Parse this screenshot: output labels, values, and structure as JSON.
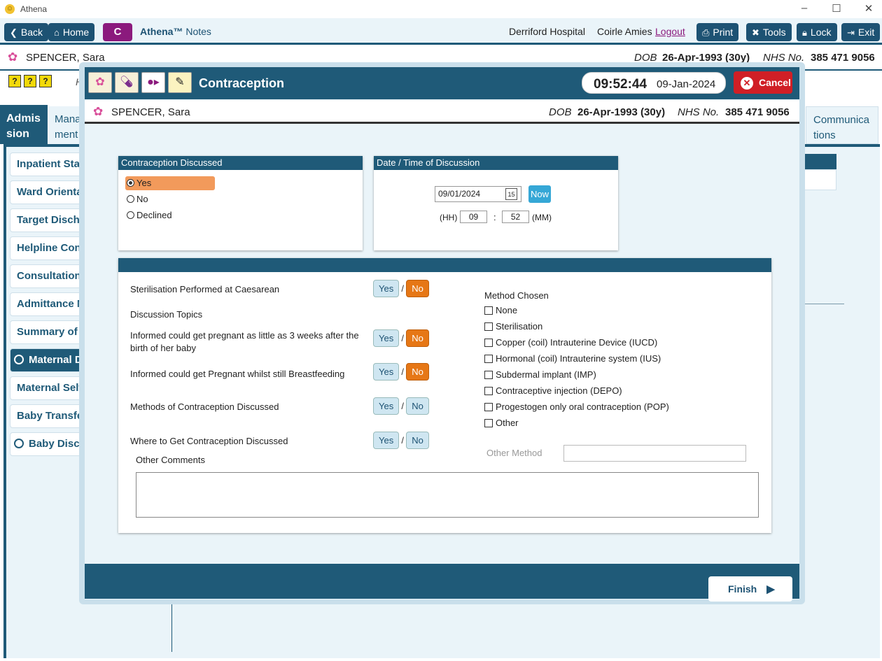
{
  "window": {
    "title": "Athena"
  },
  "topbar": {
    "back": "Back",
    "home": "Home",
    "c": "C",
    "brand_a": "Athena™",
    "brand_b": "Notes",
    "hospital": "Derriford Hospital",
    "user": "Coirle Amies",
    "logout": "Logout",
    "print": "Print",
    "tools": "Tools",
    "lock": "Lock",
    "exit": "Exit"
  },
  "patient": {
    "name": "SPENCER, Sara",
    "dob_label": "DOB",
    "dob": "26-Apr-1993 (30y)",
    "nhs_label": "NHS No.",
    "nhs": "385 471 9056"
  },
  "background": {
    "h_label": "H",
    "tabs": [
      "Admis sion",
      "Mana ment",
      "Communica tions"
    ],
    "items": [
      "Inpatient Stay",
      "Ward Orientat",
      "Target Dischar",
      "Helpline Cont",
      "Consultation I",
      "Admittance N",
      "Summary of P",
      "Maternal Di",
      "Maternal Self",
      "Baby Transfer",
      "Baby Discha"
    ]
  },
  "modal": {
    "title": "Contraception",
    "time": "09:52:44",
    "date": "09-Jan-2024",
    "cancel": "Cancel",
    "discussed": {
      "header": "Contraception Discussed",
      "options": [
        "Yes",
        "No",
        "Declined"
      ],
      "selected": "Yes"
    },
    "datetime": {
      "header": "Date / Time of Discussion",
      "date": "09/01/2024",
      "cal_day": "15",
      "now": "Now",
      "hh_label": "(HH)",
      "hh": "09",
      "sep": ":",
      "mm": "52",
      "mm_label": "(MM)"
    },
    "questions": [
      {
        "text": "Sterilisation Performed at Caesarean",
        "yes": "Yes",
        "no": "No",
        "sep": "/",
        "selected": "No"
      },
      {
        "text": "Informed could get pregnant as little as 3 weeks after the birth of her baby",
        "yes": "Yes",
        "no": "No",
        "sep": "/",
        "selected": "No"
      },
      {
        "text": "Informed could get Pregnant whilst still Breastfeeding",
        "yes": "Yes",
        "no": "No",
        "sep": "/",
        "selected": "No"
      },
      {
        "text": "Methods of Contraception Discussed",
        "yes": "Yes",
        "no": "No",
        "sep": "/",
        "selected": ""
      },
      {
        "text": "Where to Get Contraception Discussed",
        "yes": "Yes",
        "no": "No",
        "sep": "/",
        "selected": ""
      }
    ],
    "discussion_topics": "Discussion Topics",
    "method_chosen": "Method Chosen",
    "methods": [
      "None",
      "Sterilisation",
      "Copper (coil) Intrauterine Device (IUCD)",
      "Hormonal (coil) Intrauterine system (IUS)",
      "Subdermal implant (IMP)",
      "Contraceptive injection (DEPO)",
      "Progestogen only oral contraception (POP)",
      "Other"
    ],
    "other_method_label": "Other Method",
    "other_method_value": "",
    "other_comments_label": "Other Comments",
    "other_comments_value": "",
    "finish": "Finish"
  },
  "colors": {
    "navy": "#1f5a78",
    "orange": "#e67716",
    "purple": "#8b1a7d",
    "red": "#d01f26",
    "light": "#eaf4f9"
  }
}
